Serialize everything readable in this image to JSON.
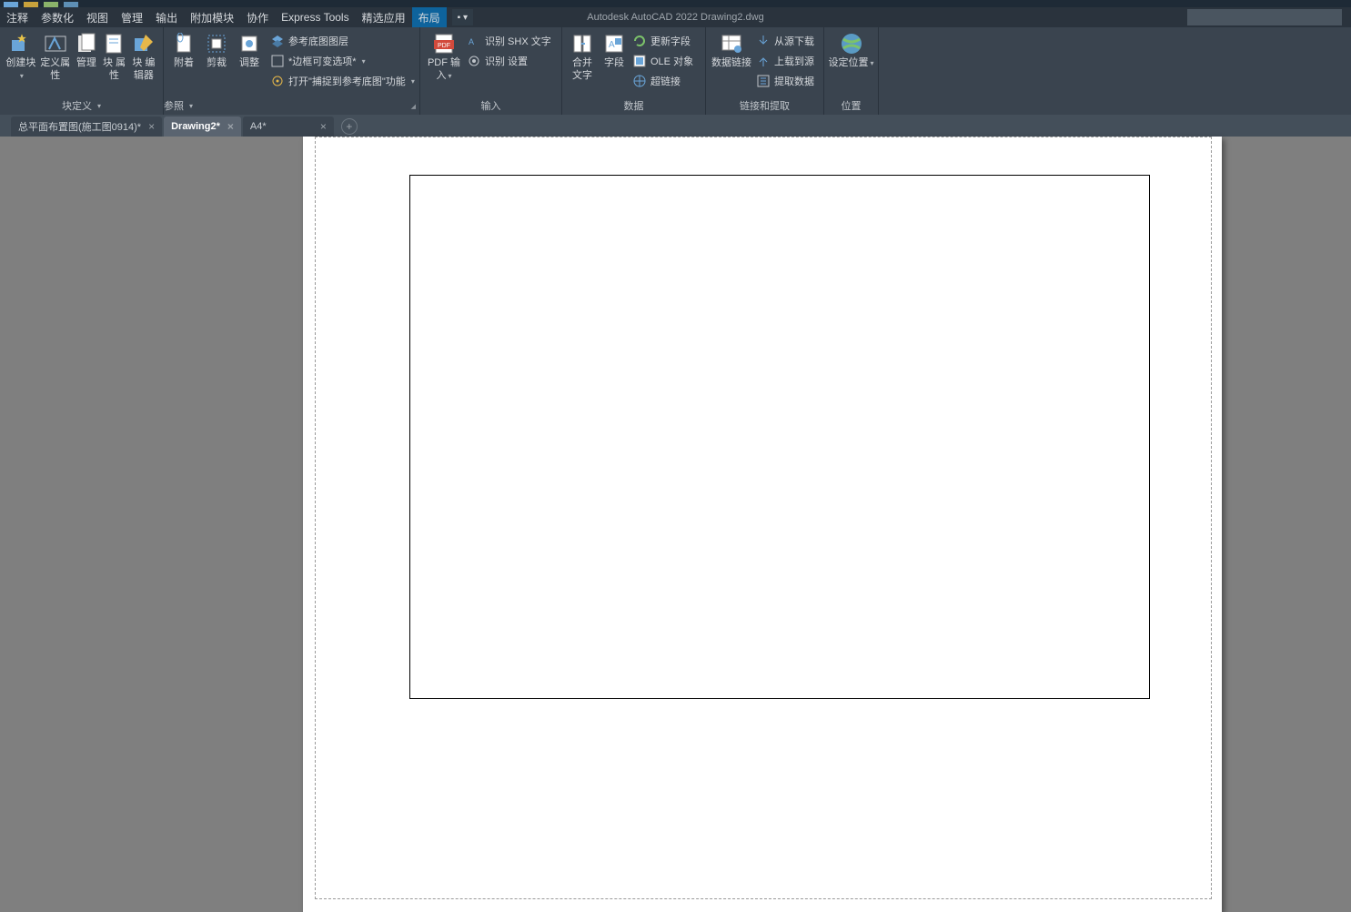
{
  "app_title": "Autodesk AutoCAD 2022  Drawing2.dwg",
  "menubar": {
    "items": [
      "注释",
      "参数化",
      "视图",
      "管理",
      "输出",
      "附加模块",
      "协作",
      "Express Tools",
      "精选应用",
      "布局"
    ],
    "active_index": 9
  },
  "ribbon": {
    "panels": [
      {
        "title": "块定义",
        "big": [
          {
            "label": "创建块",
            "icon": "sparkle"
          },
          {
            "label": "定义属性",
            "icon": "tag"
          },
          {
            "label": "管理",
            "icon": "sheets"
          },
          {
            "label": "块\n属性",
            "icon": "sheets2"
          },
          {
            "label": "块\n编辑器",
            "icon": "pencil"
          }
        ]
      },
      {
        "title": "参照",
        "big": [
          {
            "label": "附着",
            "icon": "clip-doc"
          },
          {
            "label": "剪裁",
            "icon": "clip-frame"
          },
          {
            "label": "调整",
            "icon": "clip-adjust"
          }
        ],
        "rows": [
          {
            "icon": "layers",
            "label": "参考底图图层"
          },
          {
            "icon": "frame",
            "label": "*边框可变选项*",
            "drop": true
          },
          {
            "icon": "snap",
            "label": "打开\"捕捉到参考底图\"功能",
            "drop": true
          }
        ]
      },
      {
        "title": "输入",
        "big": [
          {
            "label": "PDF\n输入",
            "icon": "pdf",
            "drop": true
          }
        ],
        "rows": [
          {
            "icon": "shx",
            "label": "识别 SHX 文字"
          },
          {
            "icon": "cog",
            "label": "识别 设置"
          }
        ]
      },
      {
        "title": "",
        "big": [
          {
            "label": "合并\n文字",
            "icon": "merge"
          },
          {
            "label": "字段",
            "icon": "field"
          }
        ],
        "rows": [
          {
            "icon": "update",
            "label": "更新字段"
          },
          {
            "icon": "ole",
            "label": "OLE 对象"
          },
          {
            "icon": "link",
            "label": "超链接"
          }
        ],
        "title2": "数据"
      },
      {
        "title": "链接和提取",
        "big": [
          {
            "label": "数据链接",
            "icon": "datalink"
          }
        ],
        "rows": [
          {
            "icon": "dl",
            "label": "从源下载"
          },
          {
            "icon": "ul",
            "label": "上载到源"
          },
          {
            "icon": "ext",
            "label": "提取数据"
          }
        ]
      },
      {
        "title": "位置",
        "big": [
          {
            "label": "设定位置",
            "icon": "globe",
            "drop": true
          }
        ]
      }
    ]
  },
  "doctabs": {
    "tabs": [
      {
        "label": "总平面布置图(施工图0914)*"
      },
      {
        "label": "Drawing2*"
      },
      {
        "label": "A4*"
      }
    ],
    "active_index": 1
  }
}
